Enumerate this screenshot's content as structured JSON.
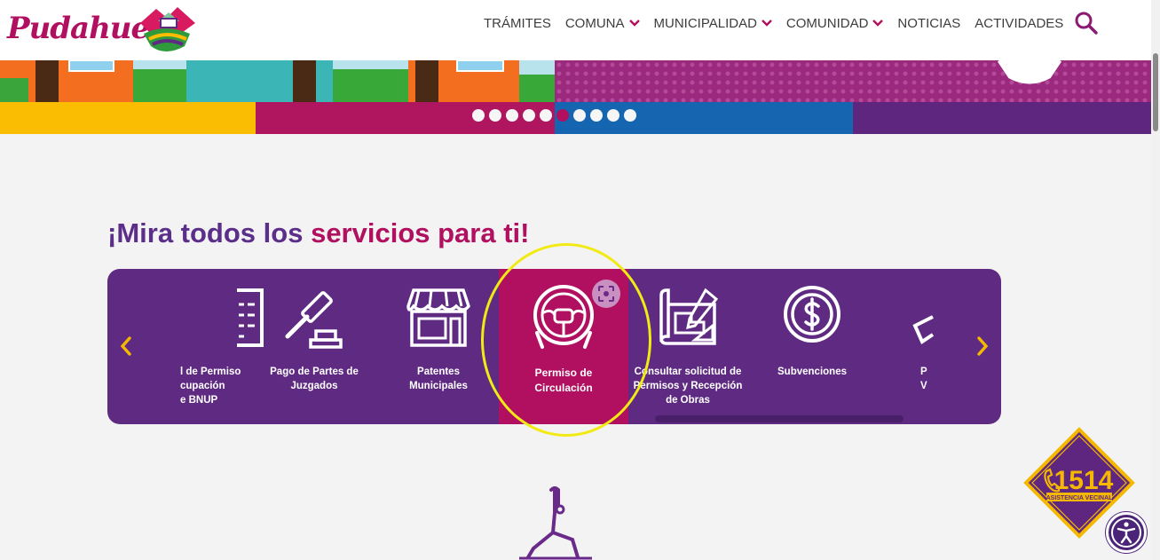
{
  "header": {
    "logo_text": "Pudahuel",
    "nav": [
      {
        "label": "TRÁMITES",
        "dropdown": false
      },
      {
        "label": "COMUNA",
        "dropdown": true
      },
      {
        "label": "MUNICIPALIDAD",
        "dropdown": true
      },
      {
        "label": "COMUNIDAD",
        "dropdown": true
      },
      {
        "label": "NOTICIAS",
        "dropdown": false
      },
      {
        "label": "ACTIVIDADES",
        "dropdown": false
      }
    ],
    "search_icon": "search-icon"
  },
  "banner": {
    "slide_count": 10,
    "active_slide": 6,
    "bar_colors": [
      "#fbbd02",
      "#b0155f",
      "#1565b0",
      "#5f2680"
    ]
  },
  "services": {
    "heading_plain": "¡Mira todos los ",
    "heading_bold": "servicios para ti!",
    "items": [
      {
        "label": "l de Permiso\ncupación\ne BNUP",
        "icon": "document-list-icon"
      },
      {
        "label": "Pago de Partes de\nJuzgados",
        "icon": "gavel-icon"
      },
      {
        "label": "Patentes\nMunicipales",
        "icon": "storefront-icon"
      },
      {
        "label": "Permiso de\nCirculación",
        "icon": "steering-wheel-icon"
      },
      {
        "label": "Consultar solicitud de\nPermisos y Recepción\nde Obras",
        "icon": "blueprint-icon"
      },
      {
        "label": "Subvenciones",
        "icon": "dollar-coin-icon"
      },
      {
        "label": "P\nV",
        "icon": "partial-service-icon"
      }
    ]
  },
  "emergency": {
    "number": "1514",
    "caption": "ASISTENCIA VECINAL"
  },
  "colors": {
    "brand_magenta": "#b0105f",
    "brand_purple": "#5f2b82",
    "accent_yellow": "#f5b800"
  }
}
